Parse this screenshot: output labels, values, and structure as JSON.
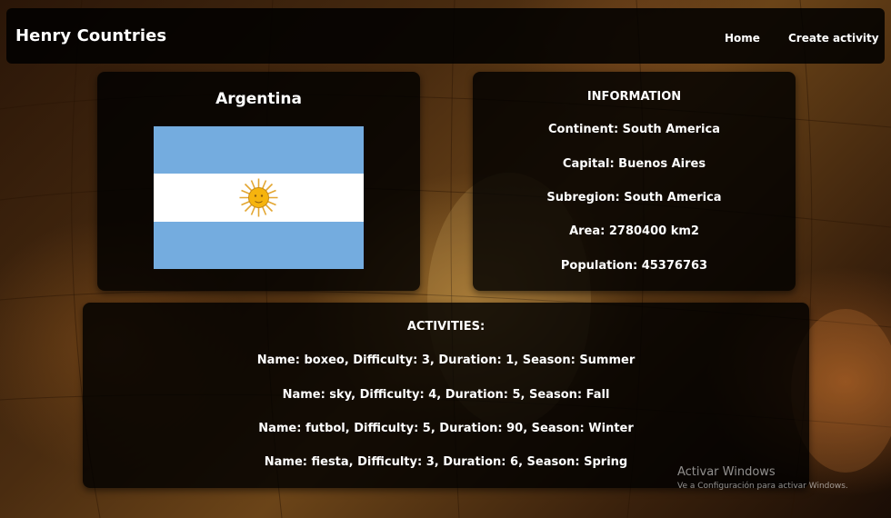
{
  "app": {
    "title": "Henry Countries"
  },
  "nav": {
    "home": "Home",
    "create_activity": "Create activity"
  },
  "country": {
    "name": "Argentina",
    "flag_colors": {
      "blue": "#74acdf",
      "white": "#ffffff",
      "sun": "#e3a631"
    }
  },
  "info": {
    "heading": "INFORMATION",
    "lines": [
      "Continent: South America",
      "Capital: Buenos Aires",
      "Subregion: South America",
      "Area: 2780400 km2",
      "Population: 45376763"
    ]
  },
  "activities": {
    "heading": "ACTIVITIES:",
    "items": [
      "Name: boxeo, Difficulty: 3, Duration: 1, Season: Summer",
      "Name: sky, Difficulty: 4, Duration: 5, Season: Fall",
      "Name: futbol, Difficulty: 5, Duration: 90, Season: Winter",
      "Name: fiesta, Difficulty: 3, Duration: 6, Season: Spring"
    ]
  },
  "watermark": {
    "title": "Activar Windows",
    "subtitle": "Ve a Configuración para activar Windows."
  }
}
